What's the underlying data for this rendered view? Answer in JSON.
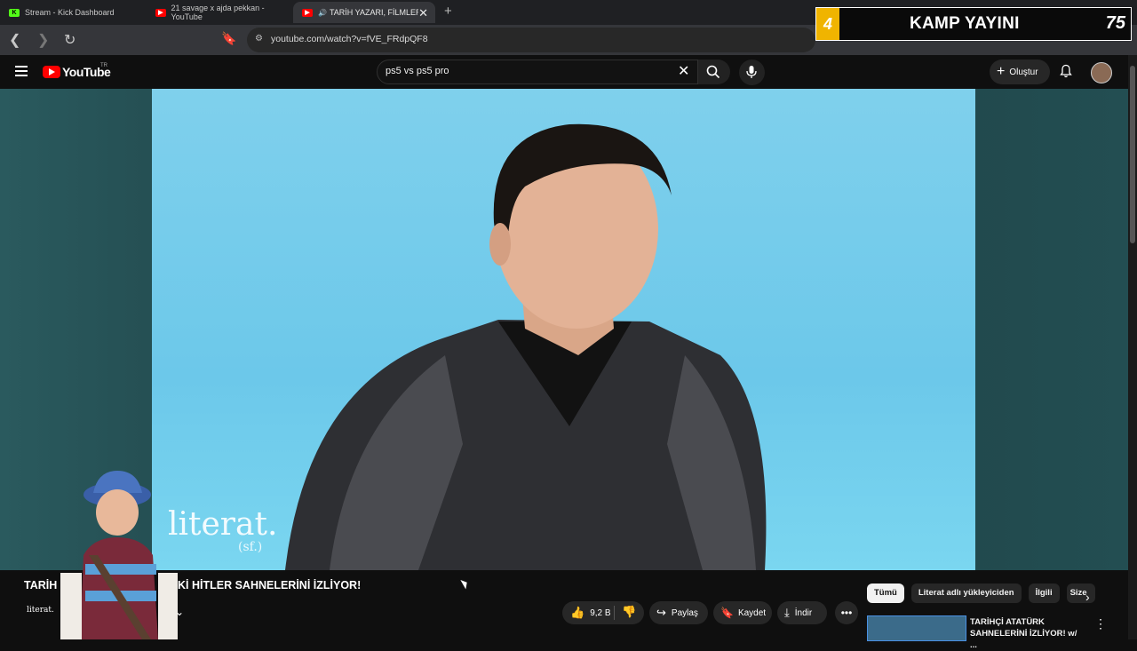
{
  "browser": {
    "tabs": [
      {
        "label": "Stream - Kick Dashboard",
        "favicon": "K"
      },
      {
        "label": "21 savage x ajda pekkan - YouTube",
        "favicon": "▶"
      },
      {
        "label": "TARİH YAZARI, FİLMLERDE",
        "favicon": "▶"
      }
    ],
    "new_tab": "+",
    "url": "youtube.com/watch?v=fVE_FRdpQF8"
  },
  "overlay": {
    "left_number": "4",
    "title": "KAMP YAYINI",
    "right_number": "75"
  },
  "youtube": {
    "logo_word": "YouTube",
    "country": "TR",
    "search_query": "ps5 vs ps5 pro",
    "create_label": "Oluştur"
  },
  "video": {
    "watermark": "literat.",
    "watermark_sub": "(sf.)",
    "title": "TARİH YAZARI, FİLMLERDEKİ HİTLER SAHNELERİNİ İZLİYOR!",
    "visible_title_prefix": "TARİH",
    "visible_title_suffix": "Kİ HİTLER SAHNELERİNİ İZLİYOR!",
    "channel_logo": "literat.",
    "like_count": "9,2 B",
    "share_label": "Paylaş",
    "save_label": "Kaydet",
    "download_label": "İndir"
  },
  "recommendations": {
    "chips": [
      "Tümü",
      "Literat adlı yükleyiciden",
      "İlgili",
      "Size"
    ],
    "first_title_line1": "TARİHÇİ ATATÜRK",
    "first_title_line2": "SAHNELERİNİ İZLİYOR! w/ ..."
  },
  "colors": {
    "bg": "#0f0f0f",
    "youtube_red": "#ff0000",
    "video_sky": "#6cc8ea",
    "overlay_accent": "#f0b400"
  }
}
